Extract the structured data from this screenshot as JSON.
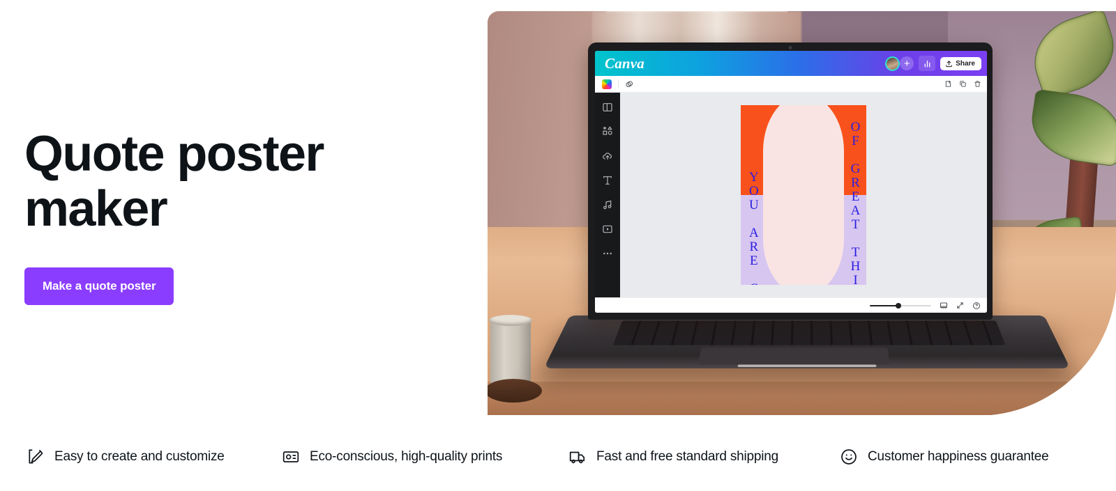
{
  "hero": {
    "title_line1": "Quote poster",
    "title_line2": "maker",
    "cta_label": "Make a quote poster",
    "cta_color": "#8b3dff",
    "text_color": "#0e1318"
  },
  "editor": {
    "brand": "Canva",
    "share_label": "Share",
    "plus_label": "+",
    "header_gradient_from": "#00c4cc",
    "header_gradient_to": "#7b3ff2",
    "header_icons": [
      {
        "name": "user-avatar",
        "label": ""
      },
      {
        "name": "add-member-icon",
        "label": "+"
      },
      {
        "name": "analytics-icon",
        "label": ""
      },
      {
        "name": "share-upload-icon",
        "label": ""
      }
    ],
    "toolbar_icons": [
      {
        "name": "color-swatch-icon"
      },
      {
        "name": "transparency-icon"
      },
      {
        "name": "position-icon"
      },
      {
        "name": "duplicate-icon"
      },
      {
        "name": "trash-icon"
      }
    ],
    "sidebar_items": [
      {
        "name": "sidebar-item-design",
        "label": "Design"
      },
      {
        "name": "sidebar-item-elements",
        "label": "Elements"
      },
      {
        "name": "sidebar-item-uploads",
        "label": "Uploads"
      },
      {
        "name": "sidebar-item-text",
        "label": "Text"
      },
      {
        "name": "sidebar-item-audio",
        "label": "Audio"
      },
      {
        "name": "sidebar-item-videos",
        "label": "Videos"
      },
      {
        "name": "sidebar-item-more",
        "label": "More"
      }
    ],
    "bottom_icons": [
      {
        "name": "zoom-slider"
      },
      {
        "name": "grid-view-icon"
      },
      {
        "name": "fullscreen-icon"
      },
      {
        "name": "help-icon",
        "label": "?"
      }
    ],
    "zoom_percent": 42,
    "canvas_bg": "#e9eaed"
  },
  "poster": {
    "line_a": "YOU ARE CAPABLE",
    "line_b": "OF GREAT THINGS.",
    "text_color": "#2a1ee0",
    "accent_orange": "#f9511b",
    "accent_purple": "#d7c6f0",
    "accent_blush": "#f9e4e3"
  },
  "features": [
    {
      "icon": "edit-pencil-icon",
      "label": "Easy to create and customize"
    },
    {
      "icon": "eco-print-icon",
      "label": "Eco-conscious, high-quality prints"
    },
    {
      "icon": "delivery-truck-icon",
      "label": "Fast and free standard shipping"
    },
    {
      "icon": "smiley-face-icon",
      "label": "Customer happiness guarantee"
    }
  ]
}
